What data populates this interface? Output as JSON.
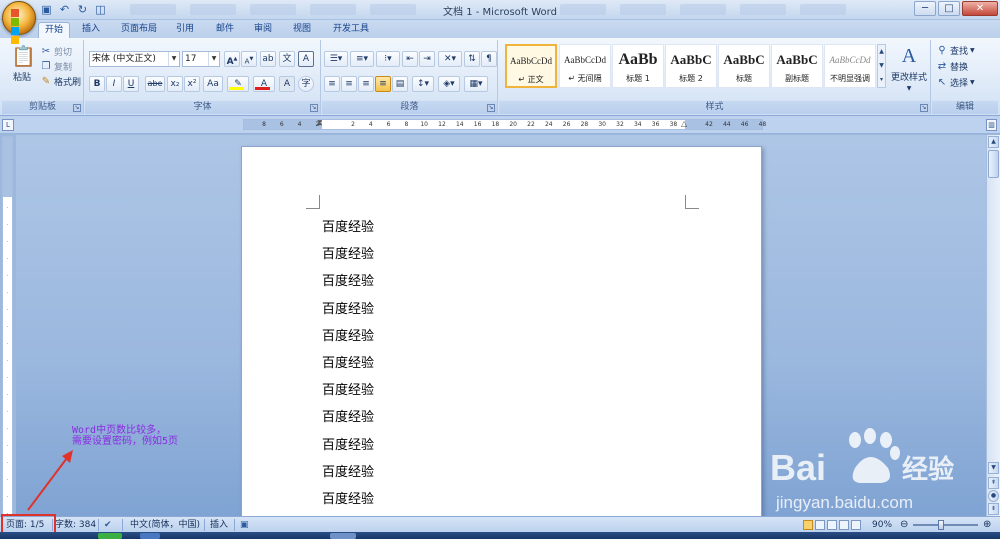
{
  "window": {
    "title": "文档 1 - Microsoft Word",
    "controls": {
      "minimize": "─",
      "maximize": "□",
      "close": "✕"
    }
  },
  "quick_access": {
    "icons": [
      "save-icon",
      "undo-icon",
      "redo-icon",
      "print-preview-icon"
    ]
  },
  "tabs": [
    {
      "label": "开始",
      "active": true
    },
    {
      "label": "插入"
    },
    {
      "label": "页面布局"
    },
    {
      "label": "引用"
    },
    {
      "label": "邮件"
    },
    {
      "label": "审阅"
    },
    {
      "label": "视图"
    },
    {
      "label": "开发工具"
    }
  ],
  "ribbon": {
    "clipboard": {
      "label": "剪贴板",
      "paste": "粘贴",
      "cut": "剪切",
      "copy": "复制",
      "format_painter": "格式刷"
    },
    "font": {
      "label": "字体",
      "font_name": "宋体 (中文正文)",
      "font_size": "17",
      "bold": "B",
      "italic": "I",
      "underline": "U",
      "strike": "abe",
      "subscript": "x₂",
      "superscript": "x²",
      "change_case": "Aa",
      "grow": "A",
      "shrink": "A",
      "highlight_color": "#ffff00",
      "font_color": "#e02020"
    },
    "paragraph": {
      "label": "段落"
    },
    "styles": {
      "label": "样式",
      "items": [
        {
          "sample": "AaBbCcDd",
          "name": "↵ 正文",
          "selected": true
        },
        {
          "sample": "AaBbCcDd",
          "name": "↵ 无间隔"
        },
        {
          "sample": "AaBb",
          "name": "标题 1"
        },
        {
          "sample": "AaBbC",
          "name": "标题 2"
        },
        {
          "sample": "AaBbC",
          "name": "标题"
        },
        {
          "sample": "AaBbC",
          "name": "副标题"
        },
        {
          "sample": "AaBbCcDd",
          "name": "不明显强调"
        }
      ],
      "change_styles": "更改样式"
    },
    "editing": {
      "label": "编辑",
      "find": "查找",
      "replace": "替换",
      "select": "选择"
    }
  },
  "ruler": {
    "ticks": [
      "8",
      "6",
      "4",
      "2",
      "",
      "2",
      "4",
      "6",
      "8",
      "10",
      "12",
      "14",
      "16",
      "18",
      "20",
      "22",
      "24",
      "26",
      "28",
      "30",
      "32",
      "34",
      "36",
      "38",
      "",
      "42",
      "44",
      "46",
      "48"
    ],
    "corner_icon": "tab-selector-icon"
  },
  "document": {
    "lines": [
      "百度经验",
      "百度经验",
      "百度经验",
      "百度经验",
      "百度经验",
      "百度经验",
      "百度经验",
      "百度经验",
      "百度经验",
      "百度经验",
      "百度经验"
    ]
  },
  "annotation": {
    "line1": "Word中页数比较多，",
    "line2": "需要设置密码，例如5页",
    "arrow_color": "#e0322a",
    "text_color": "#8a2be2"
  },
  "status": {
    "page": "页面: 1/5",
    "words": "字数: 384",
    "language": "中文(简体，中国)",
    "mode": "插入",
    "zoom": "90%",
    "zoom_value": 90
  },
  "watermark": {
    "brand": "Bai",
    "brand_cn": "经验",
    "url": "jingyan.baidu.com"
  }
}
